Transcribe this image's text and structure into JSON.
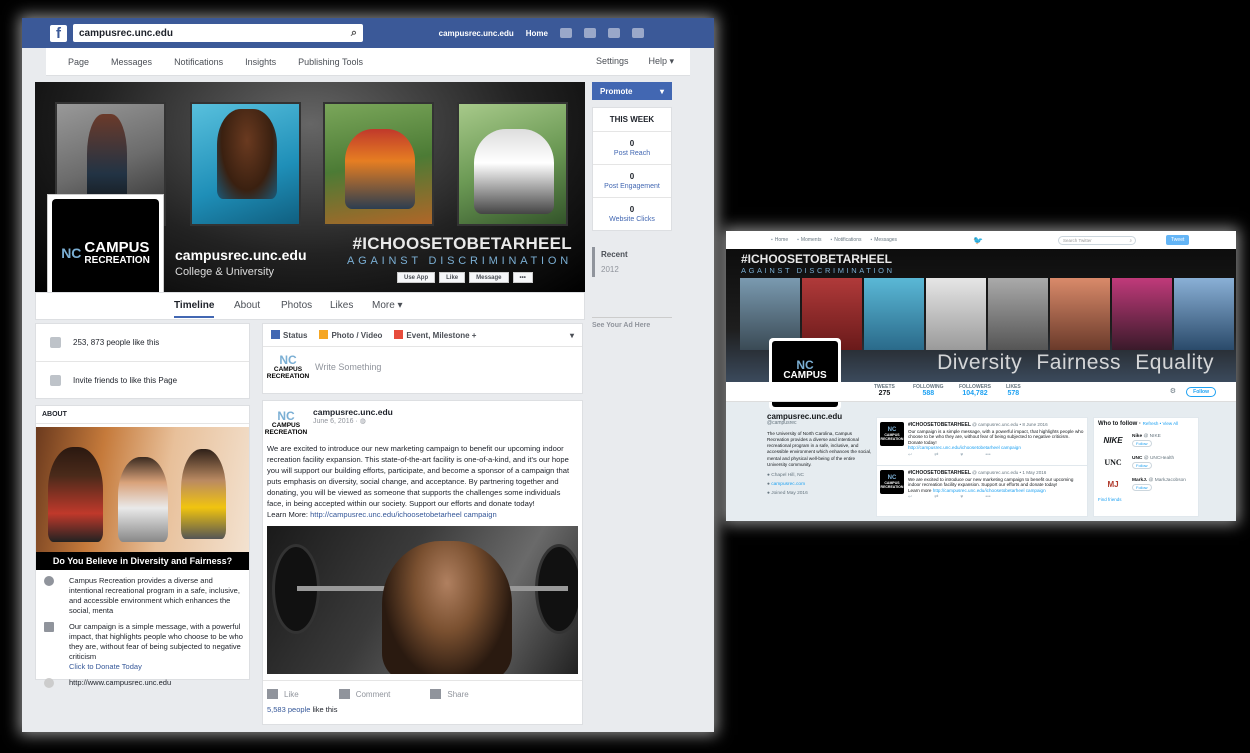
{
  "facebook": {
    "search_value": "campusrec.unc.edu",
    "topbar": {
      "page_name": "campusrec.unc.edu",
      "home": "Home"
    },
    "admin_nav": [
      "Page",
      "Messages",
      "Notifications",
      "Insights",
      "Publishing Tools"
    ],
    "admin_right": [
      "Settings",
      "Help ▾"
    ],
    "cover": {
      "page_name": "campusrec.unc.edu",
      "category": "College & University",
      "hashtag": "#ICHOOSETOBETARHEEL",
      "tagline": "AGAINST DISCRIMINATION",
      "buttons": [
        "Use App",
        "Like",
        "Message",
        "•••"
      ]
    },
    "logo": {
      "line1": "CAMPUS",
      "line2": "RECREATION",
      "mark": "NC"
    },
    "tabs": [
      "Timeline",
      "About",
      "Photos",
      "Likes",
      "More ▾"
    ],
    "promote": {
      "label": "Promote",
      "arrow": "▾"
    },
    "this_week": {
      "title": "THIS WEEK",
      "stats": [
        {
          "value": "0",
          "label": "Post Reach"
        },
        {
          "value": "0",
          "label": "Post Engagement"
        },
        {
          "value": "0",
          "label": "Website Clicks"
        }
      ]
    },
    "years": [
      "Recent",
      "2012"
    ],
    "ad_here": "See Your Ad Here",
    "likes_card": {
      "likes": "253, 873 people like this",
      "invite": "Invite friends to like this Page"
    },
    "about": {
      "title": "ABOUT",
      "banner": "Do You Believe in Diversity and Fairness?",
      "desc": "Campus Recreation provides a diverse and intentional recreational program in a safe, inclusive, and accessible environment which enhances the social, menta",
      "campaign": "Our campaign is a simple message, with a powerful impact, that highlights people who choose to be who they are, without fear of being subjected to negative criticism",
      "donate": "Click to Donate Today",
      "website": "http://www.campusrec.unc.edu"
    },
    "composer": {
      "tabs": [
        "Status",
        "Photo / Video",
        "Event, Milestone +"
      ],
      "placeholder": "Write Something"
    },
    "post": {
      "author": "campusrec.unc.edu",
      "date": "June 6, 2016 · ",
      "text": "We are excited to introduce our new marketing campaign to benefit our upcoming indoor recreation facility expansion. This state-of-the-art facility is one-of-a-kind, and it's our hope you will support our building efforts, participate, and become a sponsor of a campaign that puts emphasis on diversity, social change, and acceptance. By partnering together and donating, you will be viewed as someone that supports the challenges some individuals face, in being accepted within our society. Support our efforts and donate today!",
      "learn_more_label": "Learn More:",
      "learn_more_link": "http://campusrec.unc.edu/ichoosetobetarheel campaign",
      "actions": [
        "Like",
        "Comment",
        "Share"
      ],
      "likes_count": "5,583 people",
      "likes_suffix": " like this"
    }
  },
  "twitter": {
    "nav": [
      "Home",
      "Moments",
      "Notifications",
      "Messages"
    ],
    "search_placeholder": "Search Twitter",
    "tweet_button": "Tweet",
    "header": {
      "hashtag": "#ICHOOSETOBETARHEEL",
      "tagline": "AGAINST DISCRIMINATION",
      "words": "Diversity Fairness Equality"
    },
    "stats": [
      {
        "label": "TWEETS",
        "value": "275"
      },
      {
        "label": "FOLLOWING",
        "value": "588"
      },
      {
        "label": "FOLLOWERS",
        "value": "104,782"
      },
      {
        "label": "LIKES",
        "value": "578"
      }
    ],
    "follow": "Follow",
    "profile": {
      "name": "campusrec.unc.edu",
      "handle": "@campusrec",
      "bio": "The University of North Carolina, Campus Recreation provides a diverse and intentional recreational program in a safe, inclusive, and accessible environment which enhances the social, mental and physical well-being of the entire University community.",
      "location": "Chapel Hill, NC",
      "site": "campusrec.com",
      "joined": "Joined May 2016"
    },
    "tweets": [
      {
        "name": "#ICHOOSETOBETARHEEL",
        "meta": "@ campusrec.unc.edu • 8 June 2016",
        "text": "Our campaign is a simple message, with a powerful impact, that highlights people who choose to be who they are, without fear of being subjected to negative criticism. Donate today!",
        "link": "http://campusrec.unc.edu/ichoosetobetarheel campaign"
      },
      {
        "name": "#ICHOOSETOBETARHEEL",
        "meta": "@ campusrec.unc.edu • 1 May 2016",
        "text": "We are excited to introduce our new marketing campaign to benefit our upcoming indoor recreation facility expansion. Support our efforts and donate today!",
        "learn": "Learn more",
        "link": "http://campusrec.unc.edu/ichoosetobetarheel campaign"
      }
    ],
    "who_to_follow": {
      "title": "Who to follow",
      "refresh": "Refresh • View All",
      "items": [
        {
          "name": "Nike",
          "handle": "@ NIKE",
          "logo": "NIKE"
        },
        {
          "name": "UNC",
          "handle": "@ UNCHealth",
          "logo": "UNC"
        },
        {
          "name": "MarkJ.",
          "handle": "@ MarkJacobson",
          "logo": "MJ"
        }
      ],
      "follow": "Follow",
      "find": "Find friends"
    }
  }
}
